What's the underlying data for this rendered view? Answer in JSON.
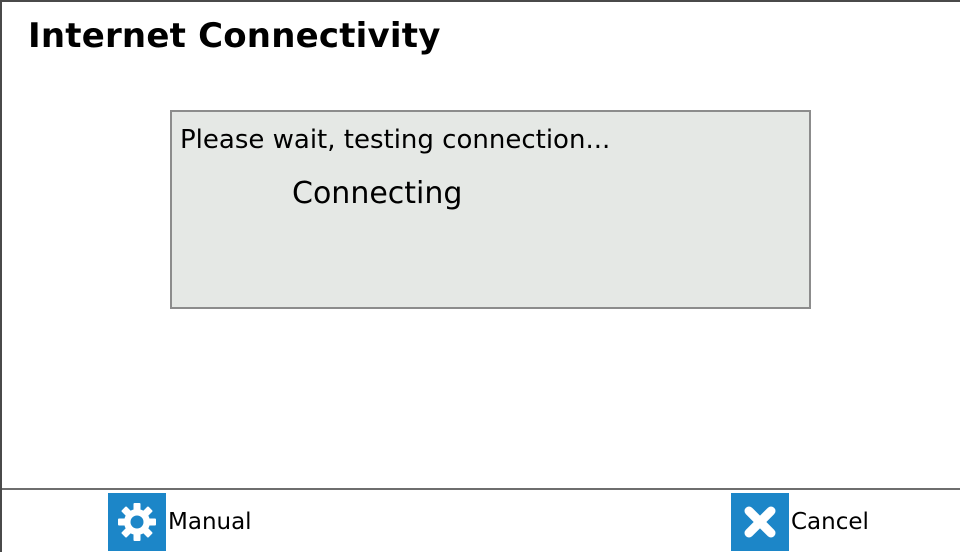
{
  "header": {
    "title": "Internet Connectivity"
  },
  "status_panel": {
    "message": "Please wait, testing connection...",
    "state": "Connecting"
  },
  "footer": {
    "manual": {
      "label": "Manual",
      "icon": "gear-icon"
    },
    "cancel": {
      "label": "Cancel",
      "icon": "close-icon"
    }
  },
  "colors": {
    "icon_tile": "#1c86c8",
    "panel_background": "#e5e8e5"
  }
}
